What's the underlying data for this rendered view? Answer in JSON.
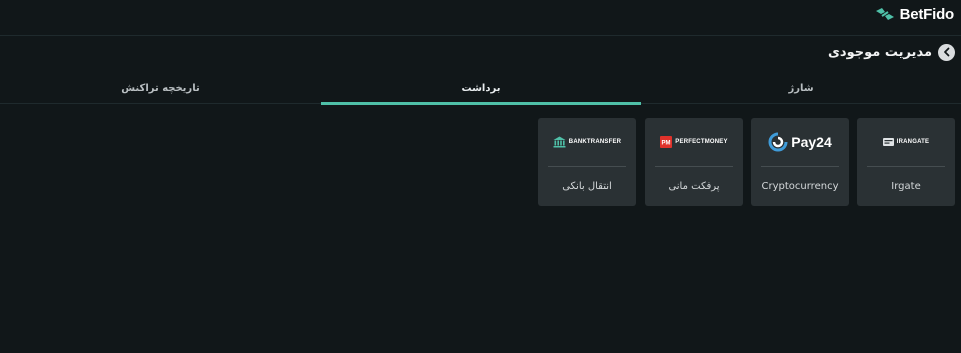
{
  "header": {
    "brand": "BetFido",
    "accent_color": "#4fc0a8"
  },
  "page": {
    "title": "مدیریت موجودی",
    "back_icon": "chevron-left-icon"
  },
  "tabs": [
    {
      "label": "شارژ",
      "active": false
    },
    {
      "label": "برداشت",
      "active": true
    },
    {
      "label": "تاریخچه تراکنش",
      "active": false
    }
  ],
  "methods": [
    {
      "brand": "IRANGATE",
      "label": "Irgate"
    },
    {
      "brand": "Pay24",
      "label": "Cryptocurrency"
    },
    {
      "brand": "PERFECTMONEY",
      "label": "پرفکت مانی"
    },
    {
      "brand": "BANKTRANSFER",
      "label": "انتقال بانکی"
    }
  ]
}
